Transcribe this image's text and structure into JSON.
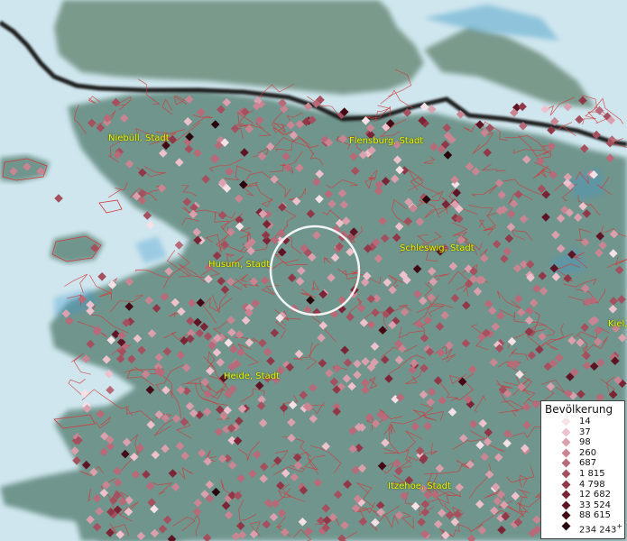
{
  "legend": {
    "title": "Bevölkerung",
    "classes": [
      {
        "label": "14",
        "color": "#f5e1e6"
      },
      {
        "label": "37",
        "color": "#edc2cc"
      },
      {
        "label": "98",
        "color": "#dba0ad"
      },
      {
        "label": "260",
        "color": "#c98592"
      },
      {
        "label": "687",
        "color": "#b86a79"
      },
      {
        "label": "1 815",
        "color": "#a5505f"
      },
      {
        "label": "4 798",
        "color": "#913848"
      },
      {
        "label": "12 682",
        "color": "#7a2435"
      },
      {
        "label": "33 524",
        "color": "#5e1424"
      },
      {
        "label": "88 615",
        "color": "#430a16"
      },
      {
        "label": "234 243",
        "color": "#28040b",
        "suffix": "+"
      }
    ]
  },
  "cities": [
    {
      "name": "Niebüll, Stadt"
    },
    {
      "name": "Flensburg, Stadt"
    },
    {
      "name": "Schleswig, Stadt"
    },
    {
      "name": "Husum, Stadt"
    },
    {
      "name": "Kiel,"
    },
    {
      "name": "Heide, Stadt"
    },
    {
      "name": "Itzehoe, Stadt"
    }
  ],
  "colors": {
    "water": "#cfe6ee",
    "land": "#6f958d",
    "denmark": "#7a9a8c",
    "border": "#1a1a1a",
    "municipality_lines": "#d23a3a",
    "selection_circle": "#ffffff"
  },
  "selection": {
    "name": "search-radius-circle"
  }
}
